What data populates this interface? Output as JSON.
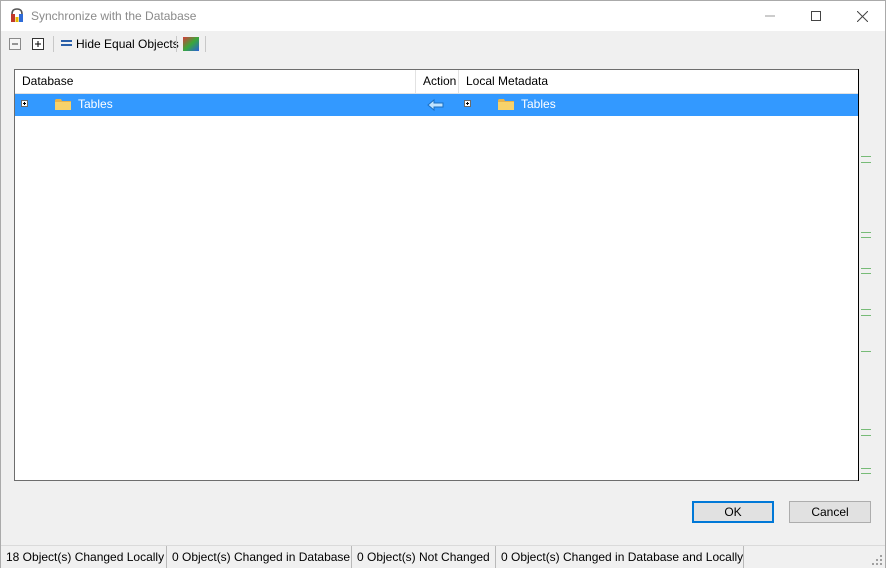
{
  "window": {
    "title": "Synchronize with the Database"
  },
  "toolbar": {
    "collapse_icon": "collapse-all-icon",
    "expand_icon": "expand-all-icon",
    "hide_equal_label": "Hide Equal Objects",
    "color_icon": "color-palette-icon"
  },
  "grid": {
    "columns": [
      "Database",
      "Action",
      "Local Metadata"
    ],
    "rows": [
      {
        "database": "Tables",
        "action": "arrow-left-icon",
        "local": "Tables",
        "selected": true
      }
    ],
    "selection_color": "#3399ff"
  },
  "buttons": {
    "ok": "OK",
    "cancel": "Cancel"
  },
  "status": [
    "18 Object(s) Changed Locally",
    "0 Object(s) Changed in Database",
    "0 Object(s) Not Changed",
    "0 Object(s) Changed in Database and Locally"
  ]
}
